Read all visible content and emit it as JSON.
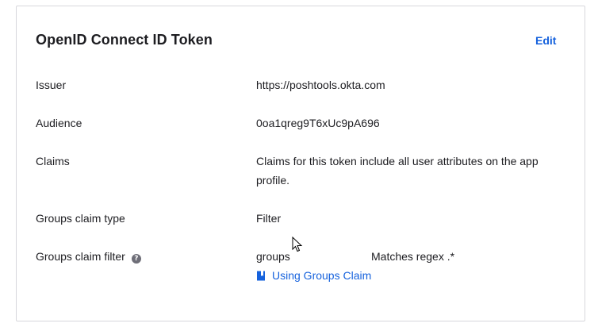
{
  "card": {
    "title": "OpenID Connect ID Token",
    "edit_label": "Edit"
  },
  "rows": [
    {
      "label": "Issuer",
      "value": "https://poshtools.okta.com"
    },
    {
      "label": "Audience",
      "value": "0oa1qreg9T6xUc9pA696"
    },
    {
      "label": "Claims",
      "value": "Claims for this token include all user attributes on the app profile."
    },
    {
      "label": "Groups claim type",
      "value": "Filter"
    },
    {
      "label": "Groups claim filter",
      "value": "groups",
      "filter_rule": "Matches regex .*",
      "info_icon": "info-icon"
    }
  ],
  "help_link": {
    "label": "Using Groups Claim",
    "icon": "book-icon"
  },
  "colors": {
    "link": "#1662dd",
    "text": "#1d1d21",
    "border": "#d7d7dc"
  }
}
